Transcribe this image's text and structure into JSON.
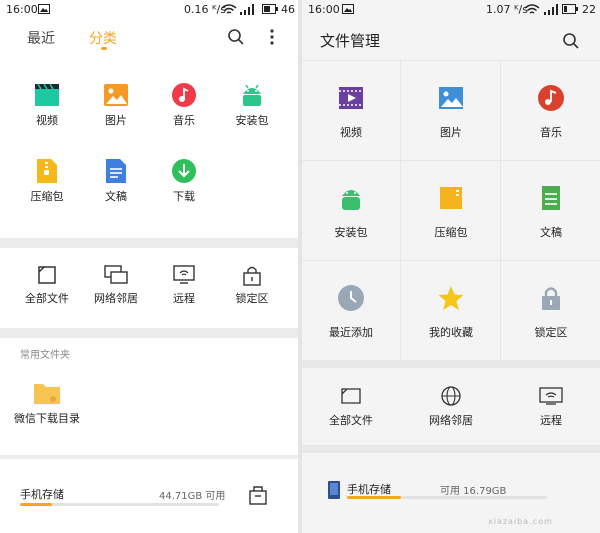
{
  "left": {
    "status": {
      "time": "16:00",
      "speed": "0.16 ᴷ/s",
      "battery": "46"
    },
    "tabs": [
      {
        "label": "最近",
        "active": false
      },
      {
        "label": "分类",
        "active": true
      }
    ],
    "categories": [
      {
        "label": "视频",
        "icon": "video-icon"
      },
      {
        "label": "图片",
        "icon": "image-icon"
      },
      {
        "label": "音乐",
        "icon": "music-icon"
      },
      {
        "label": "安装包",
        "icon": "android-icon"
      },
      {
        "label": "压缩包",
        "icon": "zip-icon"
      },
      {
        "label": "文稿",
        "icon": "document-icon"
      },
      {
        "label": "下载",
        "icon": "download-icon"
      }
    ],
    "locations": [
      {
        "label": "全部文件",
        "icon": "sd-card-icon"
      },
      {
        "label": "网络邻居",
        "icon": "network-icon"
      },
      {
        "label": "远程",
        "icon": "remote-icon"
      },
      {
        "label": "锁定区",
        "icon": "lock-icon"
      }
    ],
    "common_folders_title": "常用文件夹",
    "common_folders": [
      {
        "label": "微信下载目录",
        "icon": "folder-icon"
      }
    ],
    "storage": {
      "label": "手机存储",
      "free": "44.71GB 可用",
      "used_fraction": 0.16
    }
  },
  "right": {
    "status": {
      "time": "16:00",
      "speed": "1.07 ᴷ/s",
      "battery": "22"
    },
    "title": "文件管理",
    "grid": [
      {
        "label": "视频",
        "icon": "video-icon"
      },
      {
        "label": "图片",
        "icon": "image-icon"
      },
      {
        "label": "音乐",
        "icon": "music-icon"
      },
      {
        "label": "安装包",
        "icon": "android-icon"
      },
      {
        "label": "压缩包",
        "icon": "zip-icon"
      },
      {
        "label": "文稿",
        "icon": "document-icon"
      },
      {
        "label": "最近添加",
        "icon": "clock-icon"
      },
      {
        "label": "我的收藏",
        "icon": "star-icon"
      },
      {
        "label": "锁定区",
        "icon": "lock-icon"
      }
    ],
    "locations": [
      {
        "label": "全部文件",
        "icon": "sd-card-icon"
      },
      {
        "label": "网络邻居",
        "icon": "globe-icon"
      },
      {
        "label": "远程",
        "icon": "remote-icon"
      }
    ],
    "storage": {
      "label": "手机存储",
      "free": "可用 16.79GB",
      "used_fraction": 0.27
    },
    "watermark": "xiazaiba.com"
  }
}
